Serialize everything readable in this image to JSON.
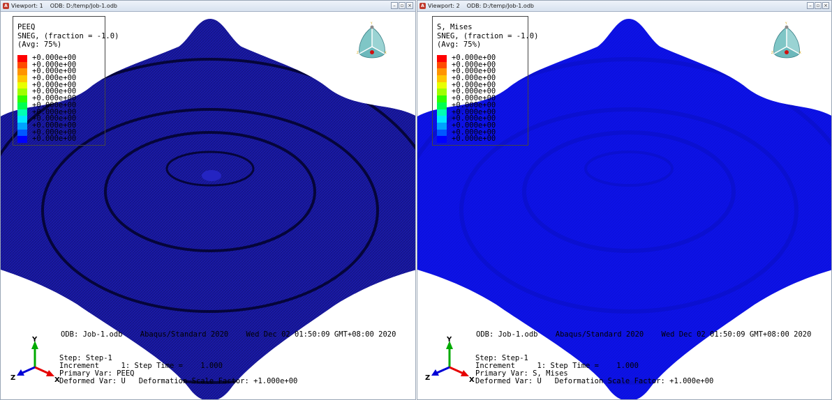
{
  "viewports": [
    {
      "title": "Viewport: 1",
      "odb_path": "ODB: D:/temp/Job-1.odb",
      "legend": {
        "variable": "PEEQ",
        "section": "SNEG, (fraction = -1.0)",
        "averaging": "(Avg: 75%)",
        "values": [
          "+0.000e+00",
          "+0.000e+00",
          "+0.000e+00",
          "+0.000e+00",
          "+0.000e+00",
          "+0.000e+00",
          "+0.000e+00",
          "+0.000e+00",
          "+0.000e+00",
          "+0.000e+00",
          "+0.000e+00",
          "+0.000e+00",
          "+0.000e+00"
        ]
      },
      "odb_line": "ODB: Job-1.odb    Abaqus/Standard 2020    Wed Dec 02 01:50:09 GMT+08:00 2020",
      "step": "Step: Step-1",
      "increment": "Increment     1: Step Time =    1.000",
      "primary_var": "Primary Var: PEEQ",
      "deformed_var": "Deformed Var: U   Deformation Scale Factor: +1.000e+00",
      "model_color": "#1a1aa8",
      "ring_color": "#05053a"
    },
    {
      "title": "Viewport: 2",
      "odb_path": "ODB: D:/temp/Job-1.odb",
      "legend": {
        "variable": "S, Mises",
        "section": "SNEG, (fraction = -1.0)",
        "averaging": "(Avg: 75%)",
        "values": [
          "+0.000e+00",
          "+0.000e+00",
          "+0.000e+00",
          "+0.000e+00",
          "+0.000e+00",
          "+0.000e+00",
          "+0.000e+00",
          "+0.000e+00",
          "+0.000e+00",
          "+0.000e+00",
          "+0.000e+00",
          "+0.000e+00",
          "+0.000e+00"
        ]
      },
      "odb_line": "ODB: Job-1.odb    Abaqus/Standard 2020    Wed Dec 02 01:50:09 GMT+08:00 2020",
      "step": "Step: Step-1",
      "increment": "Increment     1: Step Time =    1.000",
      "primary_var": "Primary Var: S, Mises",
      "deformed_var": "Deformed Var: U   Deformation Scale Factor: +1.000e+00",
      "model_color": "#0d12e6",
      "ring_color": "#0a0fc4"
    }
  ],
  "legend_colors": [
    "#ff0000",
    "#ff4a00",
    "#ff9400",
    "#ffc600",
    "#e8ff00",
    "#9fff00",
    "#2eff00",
    "#00ff52",
    "#00ffb4",
    "#00e7ff",
    "#00a2ff",
    "#0058ff",
    "#0000ff"
  ],
  "axis_labels": {
    "x": "X",
    "y": "Y",
    "z": "Z"
  },
  "axis_colors": {
    "x": "#e60000",
    "y": "#00aa00",
    "z": "#0000d6"
  },
  "window_buttons": {
    "minimize": "–",
    "restore": "▫",
    "close": "×"
  }
}
